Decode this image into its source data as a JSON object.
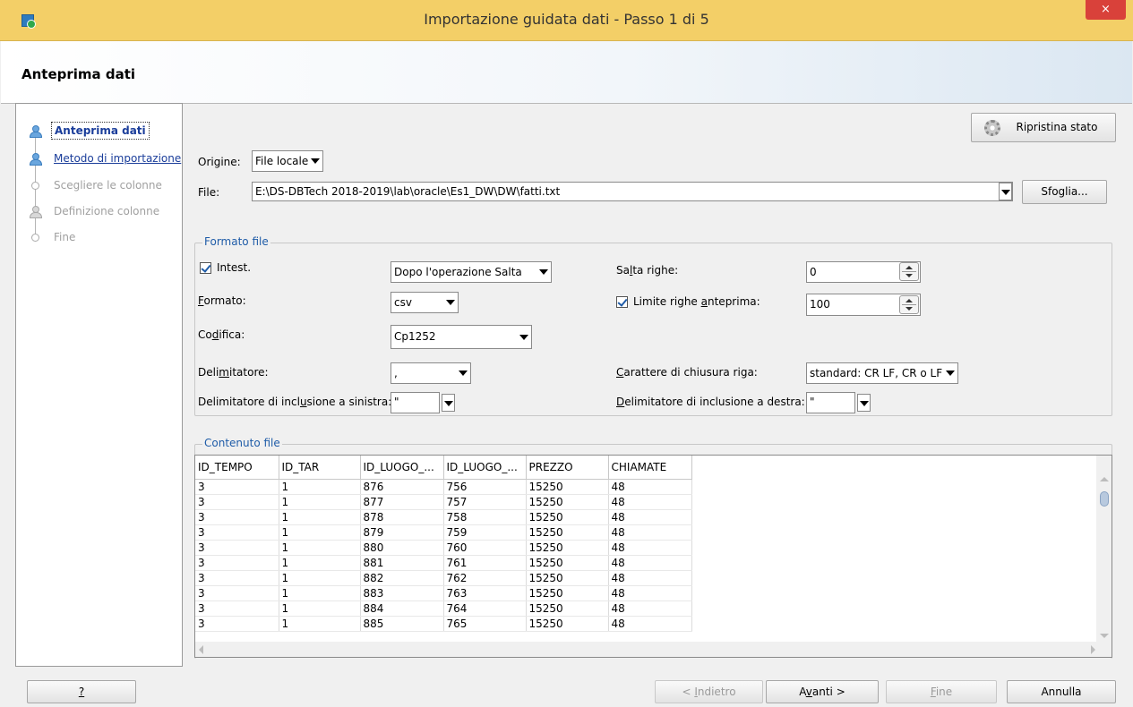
{
  "window": {
    "title": "Importazione guidata dati - Passo 1 di 5",
    "close_label": "×"
  },
  "header": {
    "title": "Anteprima dati"
  },
  "nav": {
    "items": [
      {
        "label": "Anteprima dati"
      },
      {
        "label": "Metodo di importazione"
      },
      {
        "label": "Scegliere le colonne"
      },
      {
        "label": "Definizione colonne"
      },
      {
        "label": "Fine"
      }
    ]
  },
  "toolbar": {
    "restore_label": "Ripristina stato"
  },
  "source": {
    "origin_label": "Origine:",
    "origin_value": "File locale",
    "file_label": "File:",
    "file_value": "E:\\DS-DBTech 2018-2019\\lab\\oracle\\Es1_DW\\DW\\fatti.txt",
    "browse_label": "Sfoglia..."
  },
  "format": {
    "group_title": "Formato file",
    "header_label": "Intest.",
    "header_option": "Dopo l'operazione Salta",
    "skip_rows_label": "Salta righe:",
    "skip_rows_value": "0",
    "format_label": "Formato:",
    "format_value": "csv",
    "preview_limit_label": "Limite righe anteprima:",
    "preview_limit_value": "100",
    "encoding_label": "Codifica:",
    "encoding_value": "Cp1252",
    "delimiter_label": "Delimitatore:",
    "delimiter_value": ",",
    "eol_label": "Carattere di chiusura riga:",
    "eol_value": "standard: CR LF, CR o LF",
    "left_enclosure_label": "Delimitatore di inclusione a sinistra:",
    "left_enclosure_value": "\"",
    "right_enclosure_label": "Delimitatore di inclusione a destra:",
    "right_enclosure_value": "\""
  },
  "content": {
    "group_title": "Contenuto file",
    "columns": [
      "ID_TEMPO",
      "ID_TAR",
      "ID_LUOGO_...",
      "ID_LUOGO_...",
      "PREZZO",
      "CHIAMATE"
    ],
    "rows": [
      [
        "3",
        "1",
        "876",
        "756",
        "15250",
        "48"
      ],
      [
        "3",
        "1",
        "877",
        "757",
        "15250",
        "48"
      ],
      [
        "3",
        "1",
        "878",
        "758",
        "15250",
        "48"
      ],
      [
        "3",
        "1",
        "879",
        "759",
        "15250",
        "48"
      ],
      [
        "3",
        "1",
        "880",
        "760",
        "15250",
        "48"
      ],
      [
        "3",
        "1",
        "881",
        "761",
        "15250",
        "48"
      ],
      [
        "3",
        "1",
        "882",
        "762",
        "15250",
        "48"
      ],
      [
        "3",
        "1",
        "883",
        "763",
        "15250",
        "48"
      ],
      [
        "3",
        "1",
        "884",
        "764",
        "15250",
        "48"
      ],
      [
        "3",
        "1",
        "885",
        "765",
        "15250",
        "48"
      ]
    ]
  },
  "footer": {
    "help_label": "?",
    "back_label": "< Indietro",
    "next_label": "Avanti >",
    "finish_label": "Fine",
    "cancel_label": "Annulla"
  }
}
